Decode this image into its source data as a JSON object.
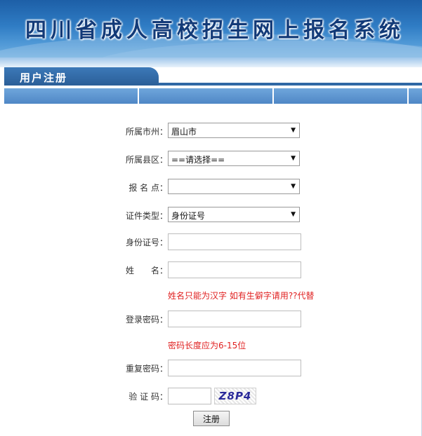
{
  "banner": {
    "title": "四川省成人高校招生网上报名系统"
  },
  "section": {
    "title": "用户注册"
  },
  "form": {
    "city_label": "所属市州：",
    "city_value": "眉山市",
    "county_label": "所属县区：",
    "county_value": "==请选择==",
    "site_label": "报 名 点：",
    "site_value": "",
    "idtype_label": "证件类型：",
    "idtype_value": "身份证号",
    "idnum_label": "身份证号：",
    "idnum_value": "",
    "name_label": "姓　　名：",
    "name_value": "",
    "name_hint": "姓名只能为汉字 如有生僻字请用??代替",
    "password_label": "登录密码：",
    "password_value": "",
    "password_hint": "密码长度应为6-15位",
    "repeat_label": "重复密码：",
    "repeat_value": "",
    "captcha_label": "验 证 码：",
    "captcha_value": "",
    "captcha_text": "Z8P4",
    "submit_label": "注册"
  },
  "colors": {
    "banner_blue": "#2f7cc4",
    "header_blue": "#2f68a5",
    "hint_red": "#e02020"
  }
}
